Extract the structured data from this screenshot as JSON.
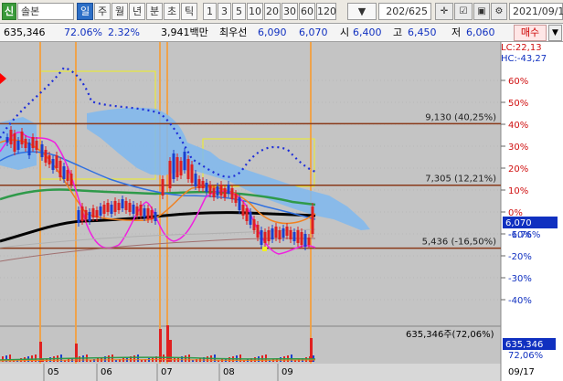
{
  "toolbar": {
    "badge": "신",
    "stock_name": "솔본",
    "periods": [
      {
        "label": "일",
        "active": true
      },
      {
        "label": "주",
        "active": false
      },
      {
        "label": "월",
        "active": false
      },
      {
        "label": "년",
        "active": false
      },
      {
        "label": "분",
        "active": false
      },
      {
        "label": "초",
        "active": false
      },
      {
        "label": "틱",
        "active": false
      }
    ],
    "intervals": [
      "1",
      "3",
      "5",
      "10",
      "20",
      "30",
      "60",
      "120"
    ],
    "count": "202/625",
    "date": "2021/09/1",
    "icons": [
      "crosshair-icon",
      "checkbox-icon",
      "save-icon",
      "gear-icon"
    ]
  },
  "info": {
    "volume": "635,346",
    "volume_ratio": "72.06%",
    "change": "2.32%",
    "amount": "3,941백만",
    "priority_label": "최우선",
    "best_ask": "6,090",
    "best_bid": "6,070",
    "open_label": "시",
    "open": "6,400",
    "high_label": "고",
    "high": "6,450",
    "low_label": "저",
    "low": "6,060",
    "buy_button": "매수"
  },
  "chart": {
    "lc_label": "LC:22,13",
    "hc_label": "HC:-43,27",
    "y_labels": [
      "60%",
      "50%",
      "40%",
      "30%",
      "20%",
      "10%",
      "0%",
      "-10%",
      "-20%",
      "-30%",
      "-40%"
    ],
    "current_price": "6,070",
    "current_change": "-6.76%",
    "hlines": [
      {
        "label": "9,130 (40,25%)",
        "value": 40.25
      },
      {
        "label": "7,305 (12,21%)",
        "value": 12.21
      },
      {
        "label": "5,436 (-16,50%)",
        "value": -16.5
      }
    ],
    "volume_label": "635,346주(72,06%)",
    "volume_value": "635,346",
    "volume_pct": "72,06%",
    "x_labels": [
      "05",
      "06",
      "07",
      "08",
      "09"
    ],
    "x_last": "09/17"
  }
}
